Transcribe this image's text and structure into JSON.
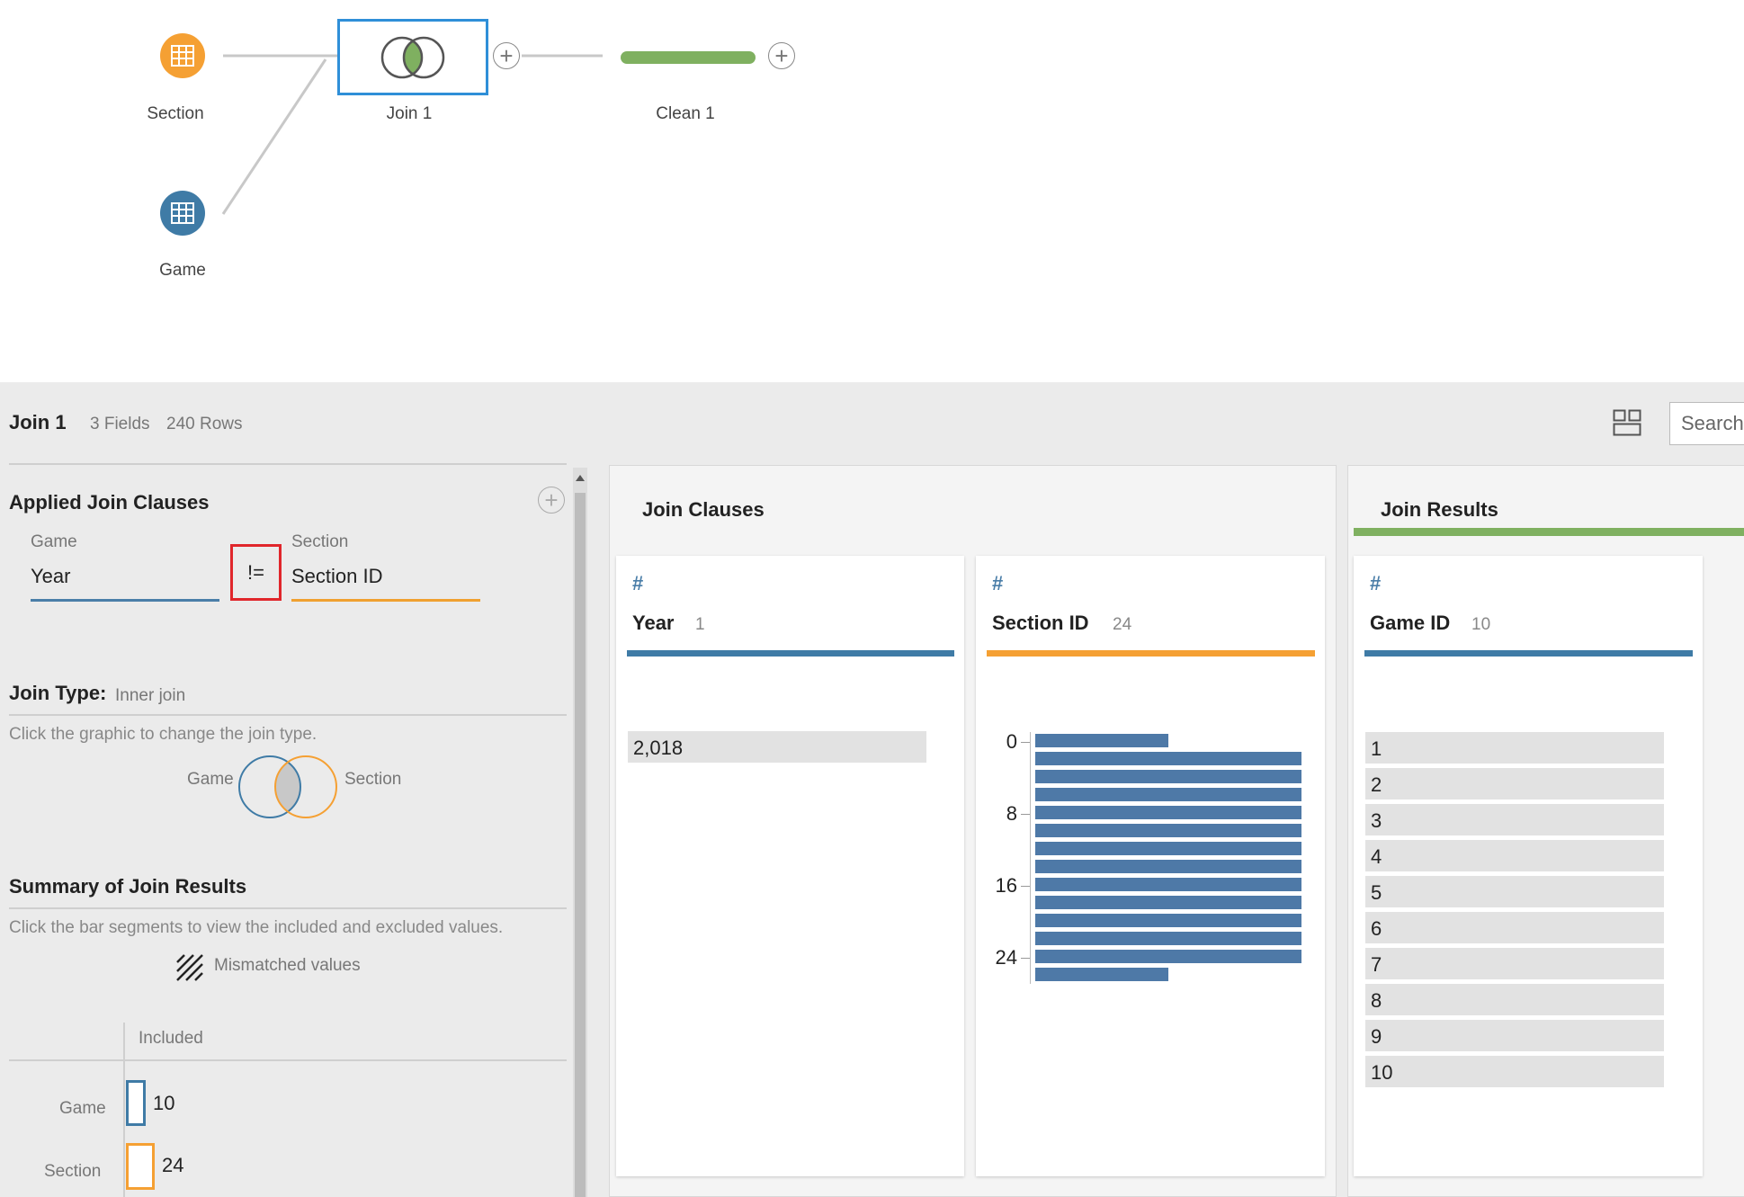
{
  "flow": {
    "nodes": [
      {
        "id": "section",
        "label": "Section",
        "color": "#f5a033",
        "icon": "table-icon"
      },
      {
        "id": "game",
        "label": "Game",
        "color": "#3f7ba6",
        "icon": "table-icon"
      },
      {
        "id": "join",
        "label": "Join 1",
        "icon": "venn-join-icon"
      },
      {
        "id": "clean",
        "label": "Clean 1",
        "color": "#7fb060"
      }
    ]
  },
  "panel": {
    "title": "Join 1",
    "fields_count": "3 Fields",
    "rows_count": "240 Rows",
    "search_placeholder": "Search"
  },
  "applied": {
    "heading": "Applied Join Clauses",
    "left_source": "Game",
    "left_field": "Year",
    "operator": "!=",
    "right_source": "Section",
    "right_field": "Section ID"
  },
  "join_type": {
    "heading": "Join Type:",
    "value": "Inner join",
    "hint": "Click the graphic to change the join type.",
    "left_label": "Game",
    "right_label": "Section"
  },
  "summary": {
    "heading": "Summary of Join Results",
    "hint": "Click the bar segments to view the included and excluded values.",
    "legend": "Mismatched values",
    "column_header": "Included",
    "rows": [
      {
        "label": "Game",
        "value": "10",
        "color": "#3f7ba6"
      },
      {
        "label": "Section",
        "value": "24",
        "color": "#f5a033"
      }
    ]
  },
  "join_clauses": {
    "title": "Join Clauses",
    "year_card": {
      "name": "Year",
      "count": "1",
      "values": [
        "2,018"
      ],
      "color": "#3f7ba6"
    },
    "section_card": {
      "name": "Section ID",
      "count": "24",
      "color": "#f5a033",
      "ticks": [
        "0",
        "8",
        "16",
        "24"
      ],
      "bin_counts": [
        1,
        2,
        2,
        2,
        2,
        2,
        2,
        2,
        2,
        2,
        2,
        2,
        2,
        1
      ]
    }
  },
  "join_results": {
    "title": "Join Results",
    "card": {
      "name": "Game ID",
      "count": "10",
      "color": "#3f7ba6",
      "values": [
        "1",
        "2",
        "3",
        "4",
        "5",
        "6",
        "7",
        "8",
        "9",
        "10"
      ]
    }
  }
}
